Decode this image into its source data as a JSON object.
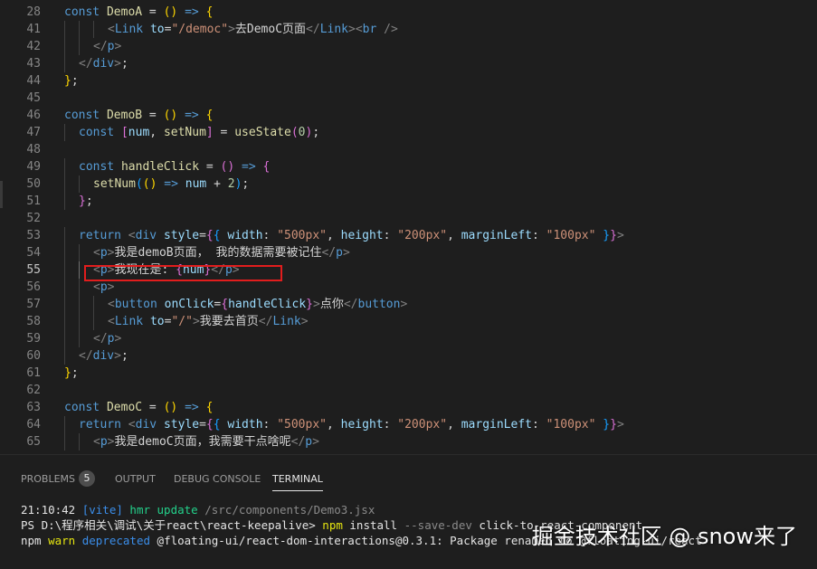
{
  "editor": {
    "lines": [
      {
        "n": "28",
        "ind": 0,
        "s": [
          [
            "kw",
            "const "
          ],
          [
            "fn",
            "DemoA"
          ],
          [
            "p",
            " = "
          ],
          [
            "b1",
            "()"
          ],
          [
            "p",
            " "
          ],
          [
            "kw",
            "=>"
          ],
          [
            "p",
            " "
          ],
          [
            "b1",
            "{"
          ]
        ]
      },
      {
        "n": "41",
        "ind": 3,
        "s": [
          [
            "angle",
            "<"
          ],
          [
            "tag",
            "Link"
          ],
          [
            "p",
            " "
          ],
          [
            "var",
            "to"
          ],
          [
            "p",
            "="
          ],
          [
            "str",
            "\"/democ\""
          ],
          [
            "angle",
            ">"
          ],
          [
            "txt",
            "去DemoC页面"
          ],
          [
            "angle",
            "</"
          ],
          [
            "tag",
            "Link"
          ],
          [
            "angle",
            "><"
          ],
          [
            "tag",
            "br"
          ],
          [
            "p",
            " "
          ],
          [
            "angle",
            "/>"
          ]
        ]
      },
      {
        "n": "42",
        "ind": 2,
        "s": [
          [
            "angle",
            "</"
          ],
          [
            "tag",
            "p"
          ],
          [
            "angle",
            ">"
          ]
        ]
      },
      {
        "n": "43",
        "ind": 1,
        "s": [
          [
            "angle",
            "</"
          ],
          [
            "tag",
            "div"
          ],
          [
            "angle",
            ">"
          ],
          [
            "p",
            ";"
          ]
        ]
      },
      {
        "n": "44",
        "ind": 0,
        "s": [
          [
            "b1",
            "}"
          ],
          [
            "p",
            ";"
          ]
        ]
      },
      {
        "n": "45",
        "ind": 0,
        "s": []
      },
      {
        "n": "46",
        "ind": 0,
        "s": [
          [
            "kw",
            "const "
          ],
          [
            "fn",
            "DemoB"
          ],
          [
            "p",
            " = "
          ],
          [
            "b1",
            "()"
          ],
          [
            "p",
            " "
          ],
          [
            "kw",
            "=>"
          ],
          [
            "p",
            " "
          ],
          [
            "b1",
            "{"
          ]
        ]
      },
      {
        "n": "47",
        "ind": 1,
        "s": [
          [
            "kw",
            "const "
          ],
          [
            "b2",
            "["
          ],
          [
            "var",
            "num"
          ],
          [
            "p",
            ", "
          ],
          [
            "fn",
            "setNum"
          ],
          [
            "b2",
            "]"
          ],
          [
            "p",
            " = "
          ],
          [
            "fn",
            "useState"
          ],
          [
            "b2",
            "("
          ],
          [
            "num",
            "0"
          ],
          [
            "b2",
            ")"
          ],
          [
            "p",
            ";"
          ]
        ]
      },
      {
        "n": "48",
        "ind": 0,
        "s": []
      },
      {
        "n": "49",
        "ind": 1,
        "s": [
          [
            "kw",
            "const "
          ],
          [
            "fn",
            "handleClick"
          ],
          [
            "p",
            " = "
          ],
          [
            "b2",
            "()"
          ],
          [
            "p",
            " "
          ],
          [
            "kw",
            "=>"
          ],
          [
            "p",
            " "
          ],
          [
            "b2",
            "{"
          ]
        ]
      },
      {
        "n": "50",
        "ind": 2,
        "s": [
          [
            "fn",
            "setNum"
          ],
          [
            "b3",
            "("
          ],
          [
            "b1",
            "()"
          ],
          [
            "p",
            " "
          ],
          [
            "kw",
            "=>"
          ],
          [
            "p",
            " "
          ],
          [
            "var",
            "num"
          ],
          [
            "p",
            " + "
          ],
          [
            "num",
            "2"
          ],
          [
            "b3",
            ")"
          ],
          [
            "p",
            ";"
          ]
        ]
      },
      {
        "n": "51",
        "ind": 1,
        "s": [
          [
            "b2",
            "}"
          ],
          [
            "p",
            ";"
          ]
        ]
      },
      {
        "n": "52",
        "ind": 0,
        "s": []
      },
      {
        "n": "53",
        "ind": 1,
        "s": [
          [
            "kw",
            "return "
          ],
          [
            "angle",
            "<"
          ],
          [
            "tag",
            "div"
          ],
          [
            "p",
            " "
          ],
          [
            "var",
            "style"
          ],
          [
            "p",
            "="
          ],
          [
            "b2",
            "{"
          ],
          [
            "b3",
            "{"
          ],
          [
            "p",
            " "
          ],
          [
            "var",
            "width"
          ],
          [
            "p",
            ": "
          ],
          [
            "str",
            "\"500px\""
          ],
          [
            "p",
            ", "
          ],
          [
            "var",
            "height"
          ],
          [
            "p",
            ": "
          ],
          [
            "str",
            "\"200px\""
          ],
          [
            "p",
            ", "
          ],
          [
            "var",
            "marginLeft"
          ],
          [
            "p",
            ": "
          ],
          [
            "str",
            "\"100px\""
          ],
          [
            "p",
            " "
          ],
          [
            "b3",
            "}"
          ],
          [
            "b2",
            "}"
          ],
          [
            "angle",
            ">"
          ]
        ]
      },
      {
        "n": "54",
        "ind": 2,
        "s": [
          [
            "angle",
            "<"
          ],
          [
            "tag",
            "p"
          ],
          [
            "angle",
            ">"
          ],
          [
            "txt",
            "我是demoB页面， 我的数据需要被记住"
          ],
          [
            "angle",
            "</"
          ],
          [
            "tag",
            "p"
          ],
          [
            "angle",
            ">"
          ]
        ]
      },
      {
        "n": "55",
        "ind": 2,
        "cur": true,
        "s": [
          [
            "angle",
            "<"
          ],
          [
            "tag",
            "p"
          ],
          [
            "angle",
            ">"
          ],
          [
            "txt",
            "我现在是: "
          ],
          [
            "b2",
            "{"
          ],
          [
            "var",
            "num"
          ],
          [
            "b2",
            "}"
          ],
          [
            "angle",
            "</"
          ],
          [
            "tag",
            "p"
          ],
          [
            "angle",
            ">"
          ]
        ]
      },
      {
        "n": "56",
        "ind": 2,
        "s": [
          [
            "angle",
            "<"
          ],
          [
            "tag",
            "p"
          ],
          [
            "angle",
            ">"
          ]
        ]
      },
      {
        "n": "57",
        "ind": 3,
        "s": [
          [
            "angle",
            "<"
          ],
          [
            "tag",
            "button"
          ],
          [
            "p",
            " "
          ],
          [
            "var",
            "onClick"
          ],
          [
            "p",
            "="
          ],
          [
            "b2",
            "{"
          ],
          [
            "var",
            "handleClick"
          ],
          [
            "b2",
            "}"
          ],
          [
            "angle",
            ">"
          ],
          [
            "txt",
            "点你"
          ],
          [
            "angle",
            "</"
          ],
          [
            "tag",
            "button"
          ],
          [
            "angle",
            ">"
          ]
        ]
      },
      {
        "n": "58",
        "ind": 3,
        "s": [
          [
            "angle",
            "<"
          ],
          [
            "tag",
            "Link"
          ],
          [
            "p",
            " "
          ],
          [
            "var",
            "to"
          ],
          [
            "p",
            "="
          ],
          [
            "str",
            "\"/\""
          ],
          [
            "angle",
            ">"
          ],
          [
            "txt",
            "我要去首页"
          ],
          [
            "angle",
            "</"
          ],
          [
            "tag",
            "Link"
          ],
          [
            "angle",
            ">"
          ]
        ]
      },
      {
        "n": "59",
        "ind": 2,
        "s": [
          [
            "angle",
            "</"
          ],
          [
            "tag",
            "p"
          ],
          [
            "angle",
            ">"
          ]
        ]
      },
      {
        "n": "60",
        "ind": 1,
        "s": [
          [
            "angle",
            "</"
          ],
          [
            "tag",
            "div"
          ],
          [
            "angle",
            ">"
          ],
          [
            "p",
            ";"
          ]
        ]
      },
      {
        "n": "61",
        "ind": 0,
        "s": [
          [
            "b1",
            "}"
          ],
          [
            "p",
            ";"
          ]
        ]
      },
      {
        "n": "62",
        "ind": 0,
        "s": []
      },
      {
        "n": "63",
        "ind": 0,
        "s": [
          [
            "kw",
            "const "
          ],
          [
            "fn",
            "DemoC"
          ],
          [
            "p",
            " = "
          ],
          [
            "b1",
            "()"
          ],
          [
            "p",
            " "
          ],
          [
            "kw",
            "=>"
          ],
          [
            "p",
            " "
          ],
          [
            "b1",
            "{"
          ]
        ]
      },
      {
        "n": "64",
        "ind": 1,
        "s": [
          [
            "kw",
            "return "
          ],
          [
            "angle",
            "<"
          ],
          [
            "tag",
            "div"
          ],
          [
            "p",
            " "
          ],
          [
            "var",
            "style"
          ],
          [
            "p",
            "="
          ],
          [
            "b2",
            "{"
          ],
          [
            "b3",
            "{"
          ],
          [
            "p",
            " "
          ],
          [
            "var",
            "width"
          ],
          [
            "p",
            ": "
          ],
          [
            "str",
            "\"500px\""
          ],
          [
            "p",
            ", "
          ],
          [
            "var",
            "height"
          ],
          [
            "p",
            ": "
          ],
          [
            "str",
            "\"200px\""
          ],
          [
            "p",
            ", "
          ],
          [
            "var",
            "marginLeft"
          ],
          [
            "p",
            ": "
          ],
          [
            "str",
            "\"100px\""
          ],
          [
            "p",
            " "
          ],
          [
            "b3",
            "}"
          ],
          [
            "b2",
            "}"
          ],
          [
            "angle",
            ">"
          ]
        ]
      },
      {
        "n": "65",
        "ind": 2,
        "s": [
          [
            "angle",
            "<"
          ],
          [
            "tag",
            "p"
          ],
          [
            "angle",
            ">"
          ],
          [
            "txt",
            "我是demoC页面，我需要干点啥呢"
          ],
          [
            "angle",
            "</"
          ],
          [
            "tag",
            "p"
          ],
          [
            "angle",
            ">"
          ]
        ]
      }
    ]
  },
  "panel": {
    "tabs": [
      {
        "id": "problems",
        "label": "PROBLEMS"
      },
      {
        "id": "output",
        "label": "OUTPUT"
      },
      {
        "id": "debug-console",
        "label": "DEBUG CONSOLE"
      },
      {
        "id": "terminal",
        "label": "TERMINAL"
      }
    ],
    "problems_count": "5",
    "terminal_lines": [
      [
        [
          "white",
          "21:10:42 "
        ],
        [
          "blue",
          "[vite] "
        ],
        [
          "green",
          "hmr update "
        ],
        [
          "gray",
          "/src/components/Demo3.jsx"
        ]
      ],
      [
        [
          "white",
          "PS D:\\程序相关\\调试\\关于react\\react-keepalive> "
        ],
        [
          "yellow",
          "npm "
        ],
        [
          "white",
          "install "
        ],
        [
          "gray",
          "--save-dev "
        ],
        [
          "white",
          "click-to-react-component"
        ]
      ],
      [
        [
          "white",
          "npm "
        ],
        [
          "yellow",
          "warn "
        ],
        [
          "blue",
          "deprecated "
        ],
        [
          "white",
          "@floating-ui/react-dom-interactions@0.3.1: Package renamed to @floating-ui/react"
        ]
      ]
    ]
  },
  "watermark": "掘金技术社区 @ snow来了",
  "colors": {
    "editor_bg": "#1e1e1e",
    "keyword": "#569cd6",
    "function": "#dcdcaa",
    "variable": "#9cdcfe",
    "string": "#ce9178",
    "number": "#b5cea8",
    "highlight_box": "#e21d1d"
  }
}
